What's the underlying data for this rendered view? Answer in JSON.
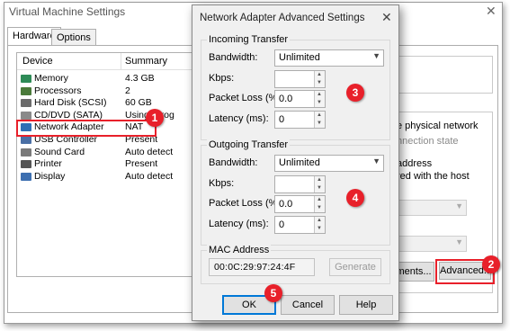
{
  "vm_window": {
    "title": "Virtual Machine Settings",
    "tabs": [
      {
        "label": "Hardware"
      },
      {
        "label": "Options"
      }
    ],
    "device_list": {
      "headers": {
        "device": "Device",
        "summary": "Summary"
      },
      "rows": [
        {
          "name": "Memory",
          "summary": "4.3 GB",
          "icon": "memory-icon",
          "color": "#2e8b57"
        },
        {
          "name": "Processors",
          "summary": "2",
          "icon": "processor-icon",
          "color": "#4a7a3a"
        },
        {
          "name": "Hard Disk (SCSI)",
          "summary": "60 GB",
          "icon": "hard-disk-icon",
          "color": "#6b6b6b"
        },
        {
          "name": "CD/DVD (SATA)",
          "summary": "Using   \\Prog",
          "icon": "cd-dvd-icon",
          "color": "#8a8a8a"
        },
        {
          "name": "Network Adapter",
          "summary": "NAT",
          "icon": "network-adapter-icon",
          "color": "#2f6fb5"
        },
        {
          "name": "USB Controller",
          "summary": "Present",
          "icon": "usb-controller-icon",
          "color": "#4a6fa5"
        },
        {
          "name": "Sound Card",
          "summary": "Auto detect",
          "icon": "sound-card-icon",
          "color": "#7a7a7a"
        },
        {
          "name": "Printer",
          "summary": "Present",
          "icon": "printer-icon",
          "color": "#555555"
        },
        {
          "name": "Display",
          "summary": "Auto detect",
          "icon": "display-icon",
          "color": "#3d6fb0"
        }
      ]
    },
    "right_panel": {
      "text1": "e physical network",
      "text2": "nnection state",
      "text3": "address",
      "text4": "red with the host",
      "segments_button": "ments...",
      "advanced_button": "Advanced..."
    }
  },
  "dialog": {
    "title": "Network Adapter Advanced Settings",
    "incoming": {
      "title": "Incoming Transfer",
      "bandwidth_label": "Bandwidth:",
      "bandwidth_value": "Unlimited",
      "kbps_label": "Kbps:",
      "kbps_value": "",
      "packet_loss_label": "Packet Loss (%):",
      "packet_loss_value": "0.0",
      "latency_label": "Latency (ms):",
      "latency_value": "0"
    },
    "outgoing": {
      "title": "Outgoing Transfer",
      "bandwidth_label": "Bandwidth:",
      "bandwidth_value": "Unlimited",
      "kbps_label": "Kbps:",
      "kbps_value": "",
      "packet_loss_label": "Packet Loss (%):",
      "packet_loss_value": "0.0",
      "latency_label": "Latency (ms):",
      "latency_value": "0"
    },
    "mac": {
      "title": "MAC Address",
      "value": "00:0C:29:97:24:4F",
      "generate_label": "Generate"
    },
    "buttons": {
      "ok": "OK",
      "cancel": "Cancel",
      "help": "Help"
    }
  },
  "callouts": [
    "1",
    "2",
    "3",
    "4",
    "5"
  ],
  "colors": {
    "callout": "#e8202a",
    "highlight_border": "#e8202a",
    "default_button_border": "#0078d7"
  }
}
